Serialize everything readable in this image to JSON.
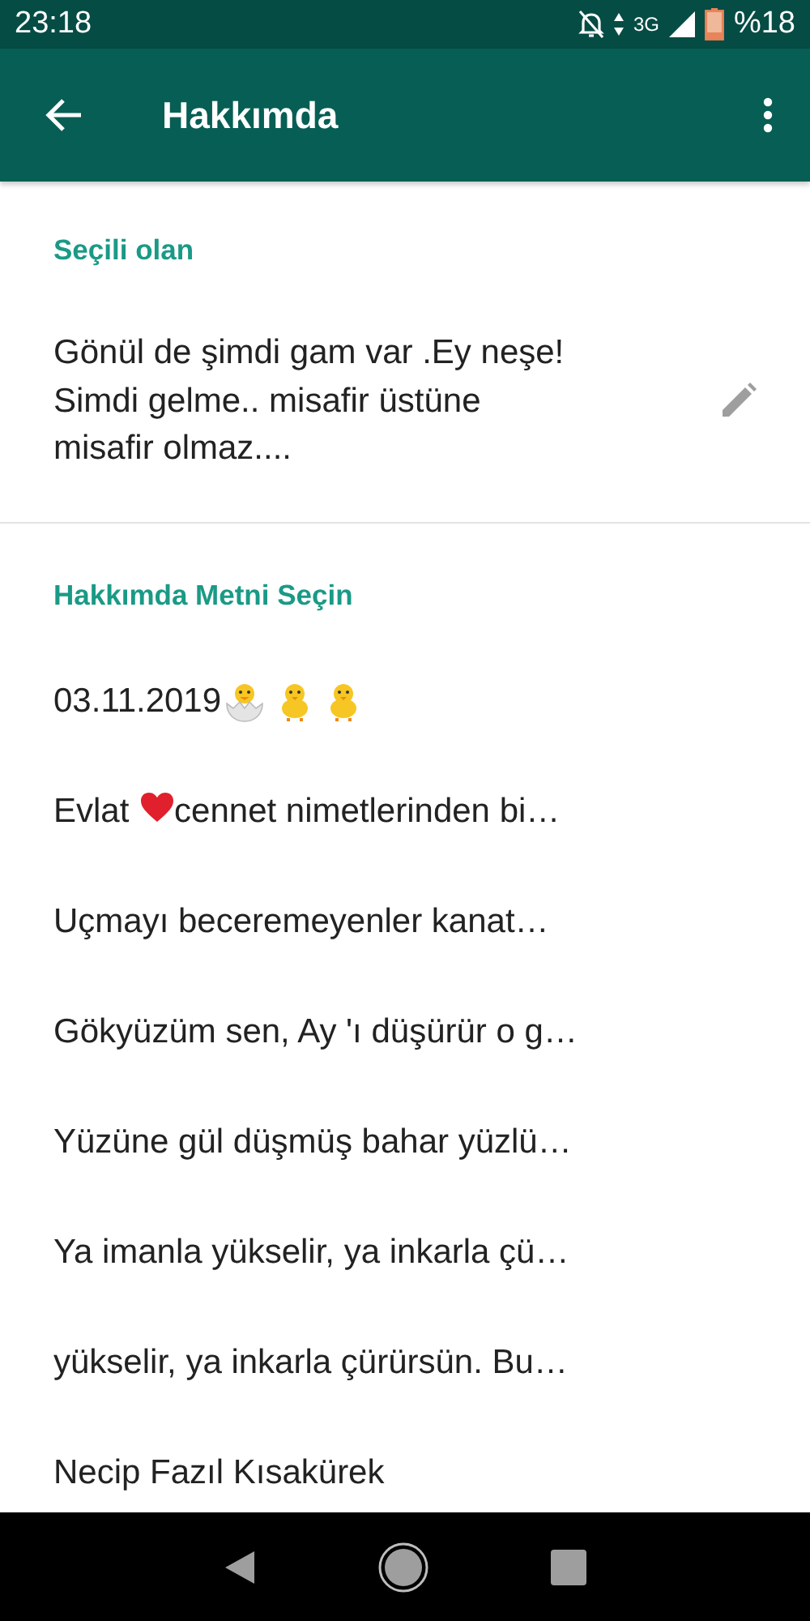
{
  "status_bar": {
    "time": "23:18",
    "network": "3G",
    "battery": "%18"
  },
  "toolbar": {
    "title": "Hakkımda"
  },
  "current": {
    "header": "Seçili olan",
    "lines": [
      "Gönül de şimdi gam var .Ey neşe!",
      "Simdi gelme.. misafir üstüne",
      "misafir olmaz...."
    ]
  },
  "choices": {
    "header": "Hakkımda Metni Seçin",
    "items": [
      [
        {
          "kind": "text",
          "text": "03.11.2019"
        },
        {
          "kind": "hatching-chick"
        },
        {
          "kind": "chick"
        },
        {
          "kind": "chick"
        }
      ],
      [
        {
          "kind": "text",
          "text": "Evlat "
        },
        {
          "kind": "heart"
        },
        {
          "kind": "text",
          "text": "cennet nimetlerinden bi…"
        }
      ],
      [
        {
          "kind": "text",
          "text": "Uçmayı beceremeyenler kanat…"
        }
      ],
      [
        {
          "kind": "text",
          "text": "Gökyüzüm sen, Ay 'ı düşürür o g…"
        }
      ],
      [
        {
          "kind": "text",
          "text": "Yüzüne gül düşmüş bahar yüzlü…"
        }
      ],
      [
        {
          "kind": "text",
          "text": "Ya imanla yükselir, ya inkarla çü…"
        }
      ],
      [
        {
          "kind": "text",
          "text": "yükselir, ya inkarla çürürsün. Bu…"
        }
      ],
      [
        {
          "kind": "text",
          "text": "Necip Fazıl Kısakürek"
        }
      ]
    ]
  }
}
